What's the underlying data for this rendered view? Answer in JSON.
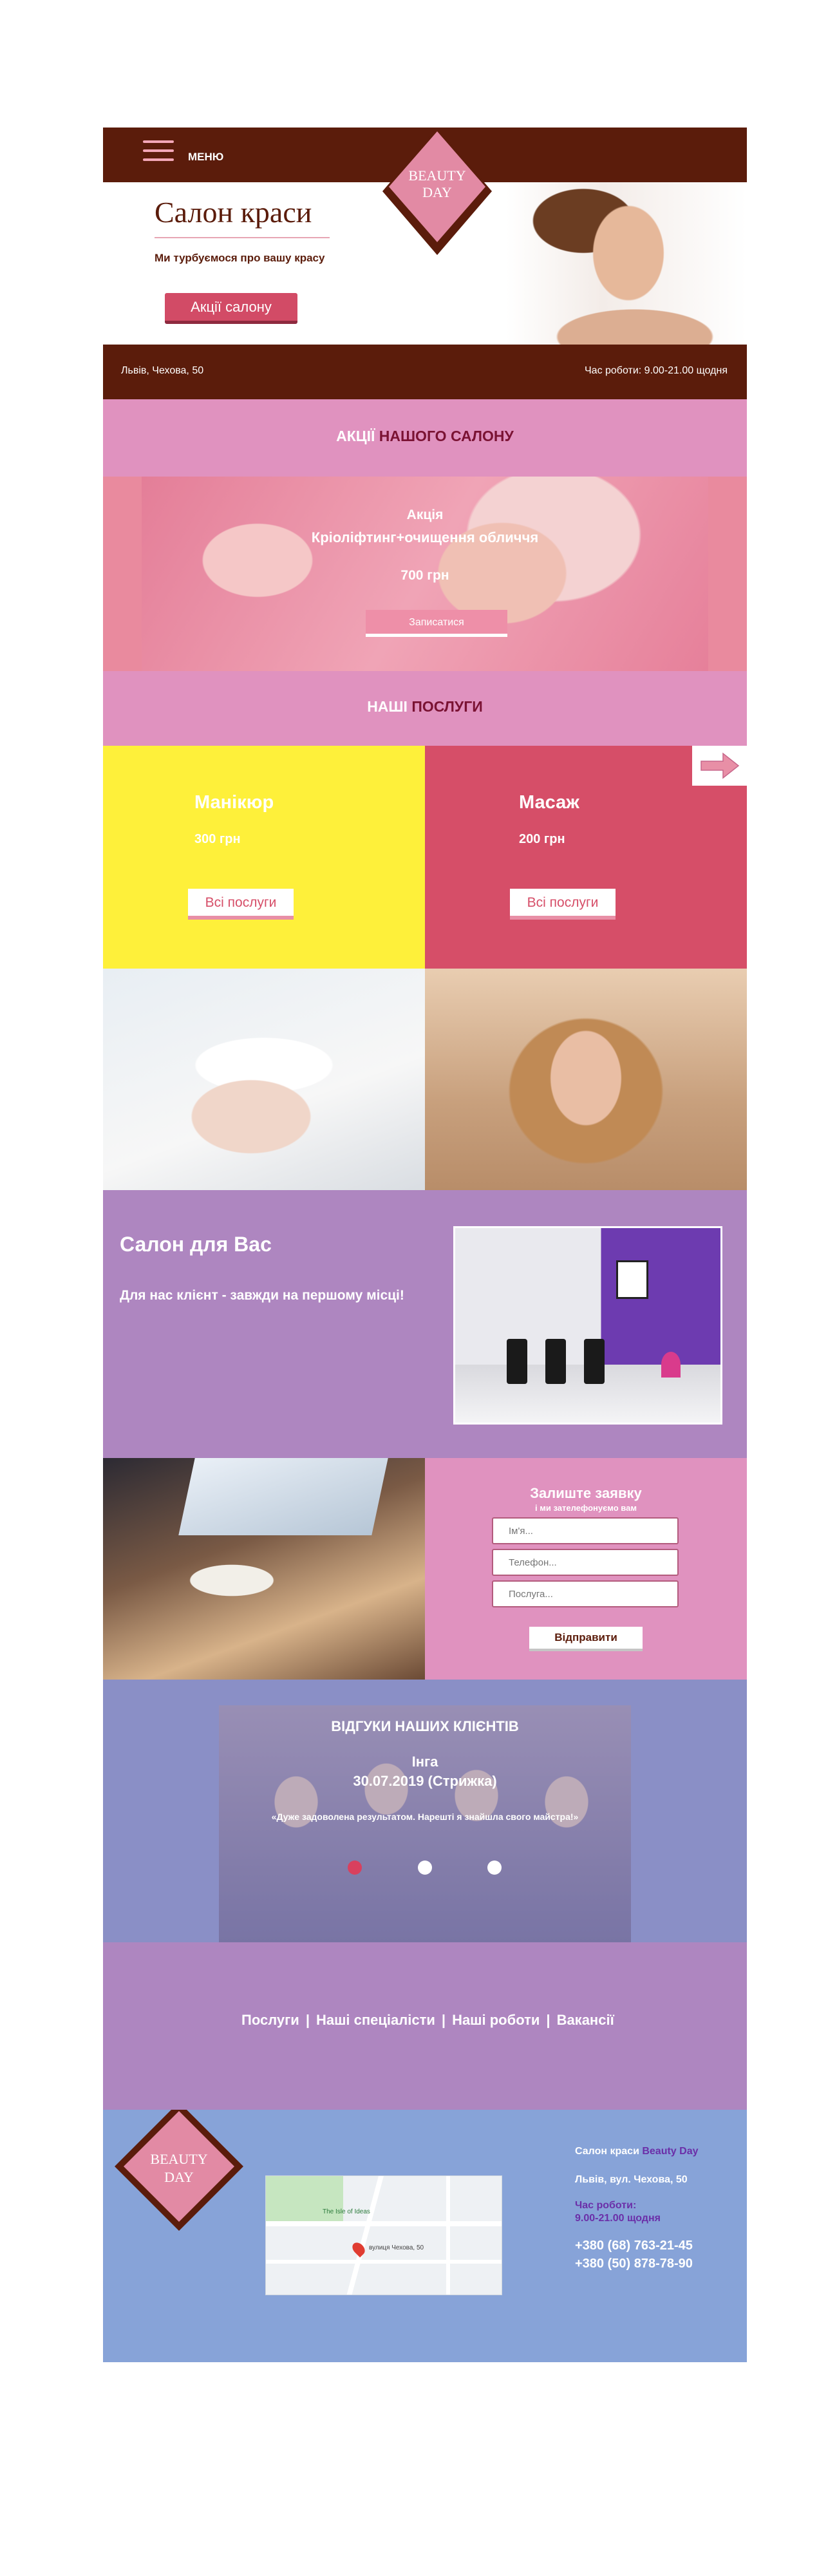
{
  "header": {
    "menu_label": "МЕНЮ",
    "logo_line1": "BEAUTY",
    "logo_line2": "DAY",
    "title": "Салон краси",
    "subtitle": "Ми турбуємося про вашу красу",
    "promo_button": "Акції салону",
    "address": "Львів, Чехова, 50",
    "hours": "Час роботи: 9.00-21.00 щодня"
  },
  "promo": {
    "heading_part1": "АКЦІЇ ",
    "heading_part2": "НАШОГО САЛОНУ",
    "label": "Акція",
    "name": "Кріоліфтинг+очищення обличчя",
    "price": "700 грн",
    "button": "Записатися"
  },
  "services": {
    "heading_part1": "НАШІ ",
    "heading_part2": "ПОСЛУГИ",
    "items": [
      {
        "name": "Манікюр",
        "price": "300 грн",
        "button": "Всі послуги"
      },
      {
        "name": "Масаж",
        "price": "200 грн",
        "button": "Всі послуги"
      }
    ]
  },
  "salon": {
    "title": "Салон для Вас",
    "subtitle": "Для нас клієнт - завжди на першому місці!"
  },
  "form": {
    "title": "Залиште заявку",
    "subtitle": "і ми зателефонуємо вам",
    "name_placeholder": "Ім'я...",
    "phone_placeholder": "Телефон...",
    "service_placeholder": "Послуга...",
    "submit": "Відправити"
  },
  "reviews": {
    "heading": "ВІДГУКИ НАШИХ КЛІЄНТІВ",
    "author": "Інга",
    "date": "30.07.2019 (Стрижка)",
    "quote": "«Дуже задоволена результатом. Нарешті я знайшла свого майстра!»"
  },
  "nav": {
    "items": [
      "Послуги",
      "Наші спеціалісти",
      "Наші роботи",
      "Вакансії"
    ],
    "separator": "|"
  },
  "footer": {
    "logo_line1": "BEAUTY",
    "logo_line2": "DAY",
    "company_prefix": "Салон краси ",
    "company_name": "Beauty Day",
    "address": "Львів, вул. Чехова, 50",
    "hours_label": "Час роботи:",
    "hours_value": "9.00-21.00 щодня",
    "phone1": "+380 (68) 763-21-45",
    "phone2": "+380 (50) 878-78-90",
    "map_street": "вулиця Чехова, 50",
    "map_place": "The Isle of Ideas"
  },
  "colors": {
    "brown": "#5b1c0b",
    "pink": "#e092bf",
    "rose": "#d64e68",
    "yellow": "#fef03a",
    "lilac": "#ae86c0",
    "periwinkle": "#8a8fc6",
    "blue": "#87a3d8"
  }
}
